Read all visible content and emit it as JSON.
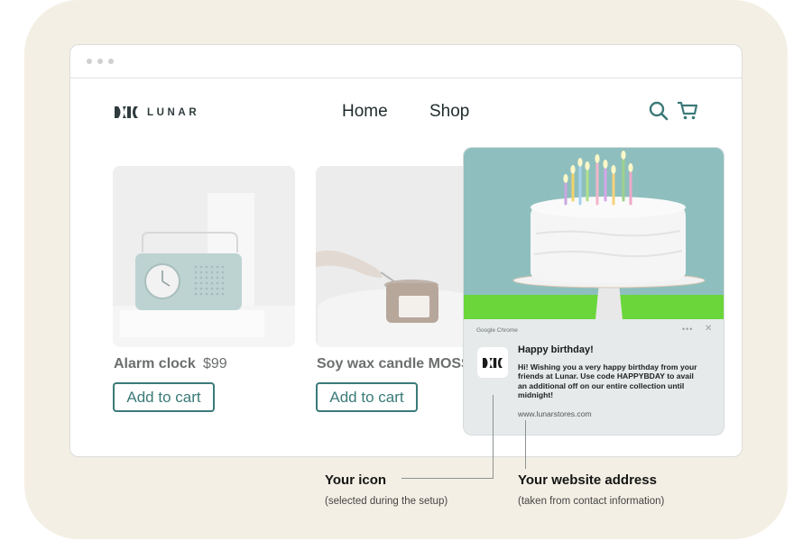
{
  "brand": {
    "name": "LUNAR"
  },
  "nav": {
    "home": "Home",
    "shop": "Shop"
  },
  "header_icons": [
    "search-icon",
    "cart-icon"
  ],
  "products": [
    {
      "name": "Alarm clock",
      "price": "$99",
      "button": "Add to cart"
    },
    {
      "name": "Soy wax candle MOSS",
      "price": "",
      "button": "Add to cart"
    }
  ],
  "notification": {
    "source": "Google Chrome",
    "title": "Happy birthday!",
    "body": "Hi! Wishing you a very happy birthday from your friends at Lunar. Use code HAPPYBDAY to avail an additional off on our entire collection until midnight!",
    "url": "www.lunarstores.com",
    "controls": [
      "more-options-icon",
      "close-icon"
    ]
  },
  "callouts": {
    "icon": {
      "title": "Your icon",
      "subtitle": "(selected during the setup)"
    },
    "website": {
      "title": "Your website address",
      "subtitle": "(taken from contact information)"
    }
  },
  "colors": {
    "accent": "#3b7a78",
    "background": "#f4efe4",
    "notification_bg": "#e6eaeb",
    "cake_backdrop": "#8ebfbe",
    "table_green": "#6ad63a"
  }
}
